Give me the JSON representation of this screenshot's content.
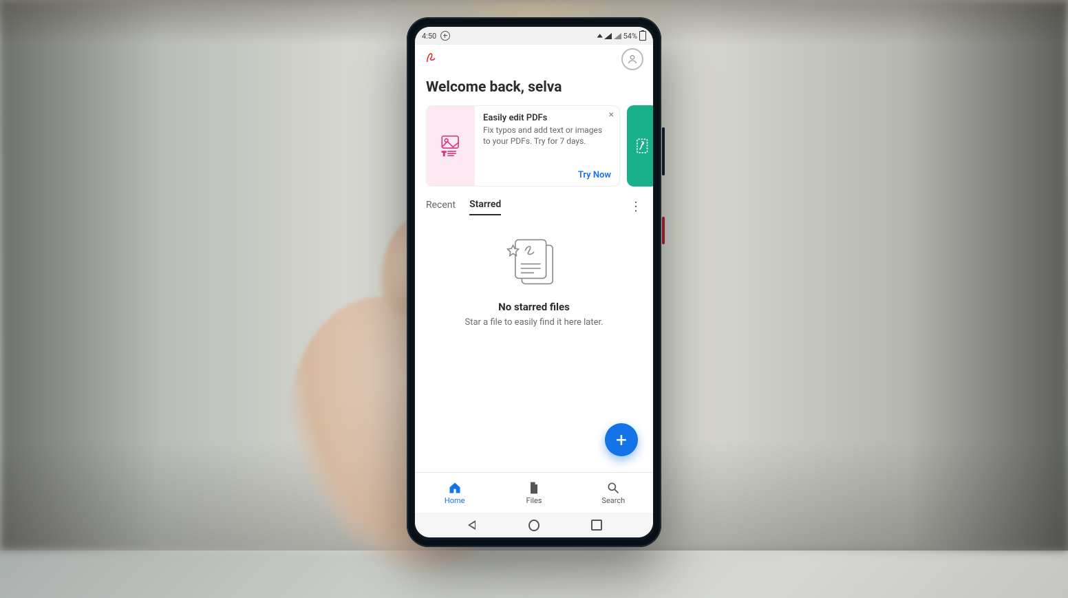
{
  "status": {
    "time": "4:50",
    "battery": "54%"
  },
  "header": {
    "greeting": "Welcome back, selva"
  },
  "promo": {
    "title": "Easily edit PDFs",
    "subtitle": "Fix typos and add text or images to your PDFs. Try for 7 days.",
    "cta": "Try Now"
  },
  "tabs": {
    "recent": "Recent",
    "starred": "Starred",
    "active": "starred"
  },
  "empty": {
    "title": "No starred files",
    "subtitle": "Star a file to easily find it here later."
  },
  "nav": {
    "home": "Home",
    "files": "Files",
    "search": "Search",
    "active": "home"
  }
}
